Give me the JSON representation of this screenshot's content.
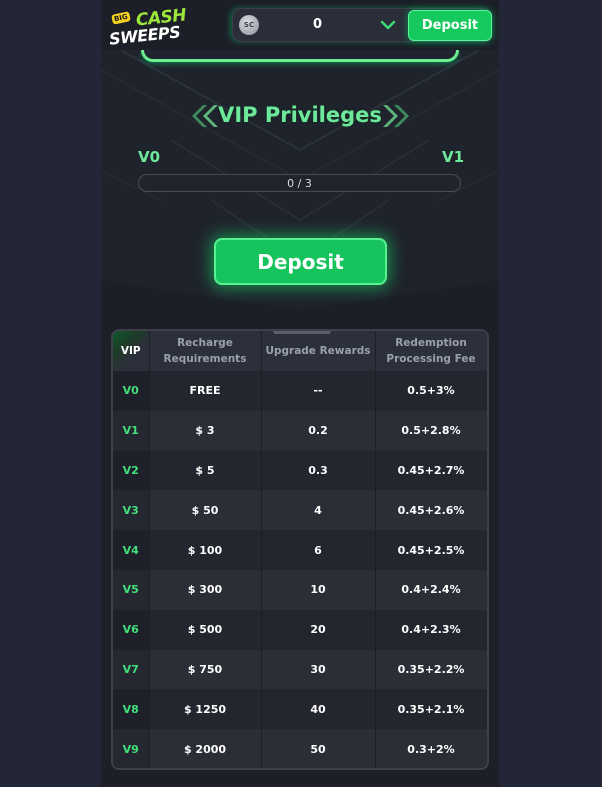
{
  "header": {
    "logo_big": "BIG",
    "logo_cash": "CASH",
    "logo_sweeps": "SWEEPS",
    "coin_label": "SC",
    "balance": "0",
    "deposit_label": "Deposit"
  },
  "vip": {
    "title": "VIP Privileges",
    "current_level": "V0",
    "next_level": "V1",
    "progress_text": "0 / 3",
    "progress_fraction": 0,
    "deposit_label": "Deposit"
  },
  "table": {
    "headers": [
      "VIP",
      "Recharge Requirements",
      "Upgrade Rewards",
      "Redemption Processing Fee"
    ],
    "rows": [
      {
        "vip": "V0",
        "recharge": "FREE",
        "reward": "--",
        "fee": "0.5+3%"
      },
      {
        "vip": "V1",
        "recharge": "$ 3",
        "reward": "0.2",
        "fee": "0.5+2.8%"
      },
      {
        "vip": "V2",
        "recharge": "$ 5",
        "reward": "0.3",
        "fee": "0.45+2.7%"
      },
      {
        "vip": "V3",
        "recharge": "$ 50",
        "reward": "4",
        "fee": "0.45+2.6%"
      },
      {
        "vip": "V4",
        "recharge": "$ 100",
        "reward": "6",
        "fee": "0.45+2.5%"
      },
      {
        "vip": "V5",
        "recharge": "$ 300",
        "reward": "10",
        "fee": "0.4+2.4%"
      },
      {
        "vip": "V6",
        "recharge": "$ 500",
        "reward": "20",
        "fee": "0.4+2.3%"
      },
      {
        "vip": "V7",
        "recharge": "$ 750",
        "reward": "30",
        "fee": "0.35+2.2%"
      },
      {
        "vip": "V8",
        "recharge": "$ 1250",
        "reward": "40",
        "fee": "0.35+2.1%"
      },
      {
        "vip": "V9",
        "recharge": "$ 2000",
        "reward": "50",
        "fee": "0.3+2%"
      }
    ]
  },
  "colors": {
    "accent": "#16c95d",
    "accent_text": "#6ee89a",
    "page_bg": "#222637",
    "panel_bg": "#1c1f28"
  },
  "icons": {
    "coin": "sc-coin-icon",
    "chevron": "chevron-down-icon",
    "arrows_left": "double-chevron-left-icon",
    "arrows_right": "double-chevron-right-icon"
  }
}
